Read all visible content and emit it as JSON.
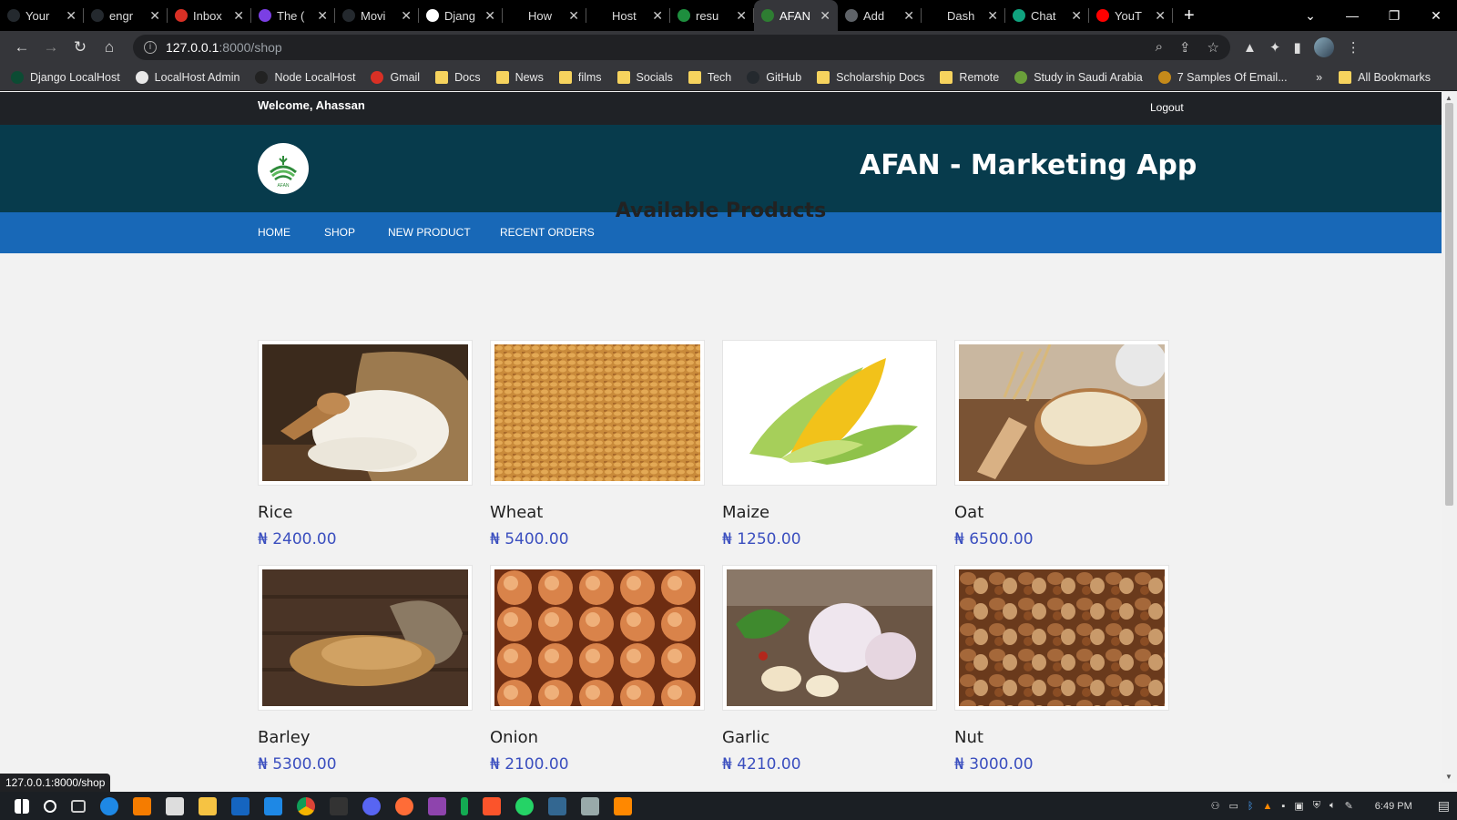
{
  "browser": {
    "tabs": [
      {
        "title": "Your",
        "color": "#24292e"
      },
      {
        "title": "engr",
        "color": "#24292e"
      },
      {
        "title": "Inbox",
        "color": "#d93025"
      },
      {
        "title": "The (",
        "color": "#7b3fe4"
      },
      {
        "title": "Movi",
        "color": "#24292e"
      },
      {
        "title": "Djang",
        "color": "#ffffff"
      },
      {
        "title": "How",
        "color": "#000000"
      },
      {
        "title": "Host",
        "color": "#000000"
      },
      {
        "title": "resu",
        "color": "#1e8e3e"
      },
      {
        "title": "AFAN",
        "color": "#2e7d32",
        "active": true
      },
      {
        "title": "Add",
        "color": "#5f6368"
      },
      {
        "title": "Dash",
        "color": "#000000"
      },
      {
        "title": "Chat",
        "color": "#10a37f"
      },
      {
        "title": "YouT",
        "color": "#ff0000"
      }
    ],
    "url_host": "127.0.0.1",
    "url_path": ":8000/shop",
    "bookmarks": [
      {
        "label": "Django LocalHost",
        "type": "site",
        "color": "#0c4b33"
      },
      {
        "label": "LocalHost Admin",
        "type": "site",
        "color": "#e8e8e8"
      },
      {
        "label": "Node LocalHost",
        "type": "site",
        "color": "#222"
      },
      {
        "label": "Gmail",
        "type": "site",
        "color": "#d93025"
      },
      {
        "label": "Docs",
        "type": "folder"
      },
      {
        "label": "News",
        "type": "folder"
      },
      {
        "label": "films",
        "type": "folder"
      },
      {
        "label": "Socials",
        "type": "folder"
      },
      {
        "label": "Tech",
        "type": "folder"
      },
      {
        "label": "GitHub",
        "type": "site",
        "color": "#24292e"
      },
      {
        "label": "Scholarship Docs",
        "type": "folder"
      },
      {
        "label": "Remote",
        "type": "folder"
      },
      {
        "label": "Study in Saudi Arabia",
        "type": "site",
        "color": "#6a9f3a"
      },
      {
        "label": "7 Samples Of Email...",
        "type": "site",
        "color": "#c58a1a"
      }
    ],
    "bookmarks_overflow": "»",
    "all_bookmarks": "All Bookmarks",
    "status_url": "127.0.0.1:8000/shop"
  },
  "site": {
    "welcome": "Welcome, Ahassan",
    "logout": "Logout",
    "app_title": "AFAN - Marketing App",
    "nav": [
      "HOME",
      "SHOP",
      "NEW PRODUCT",
      "RECENT ORDERS"
    ],
    "heading": "Available Products",
    "currency": "₦",
    "products": [
      {
        "name": "Rice",
        "price": "₦ 2400.00"
      },
      {
        "name": "Wheat",
        "price": "₦ 5400.00"
      },
      {
        "name": "Maize",
        "price": "₦ 1250.00"
      },
      {
        "name": "Oat",
        "price": "₦ 6500.00"
      },
      {
        "name": "Barley",
        "price": "₦ 5300.00"
      },
      {
        "name": "Onion",
        "price": "₦ 2100.00"
      },
      {
        "name": "Garlic",
        "price": "₦ 4210.00"
      },
      {
        "name": "Nut",
        "price": "₦ 3000.00"
      }
    ],
    "logo_text": "AFAN"
  },
  "taskbar": {
    "clock": "6:49 PM"
  },
  "colors": {
    "topbar": "#1f2226",
    "brand": "#073b4c",
    "nav": "#1868b7",
    "price": "#3b4fbf"
  }
}
